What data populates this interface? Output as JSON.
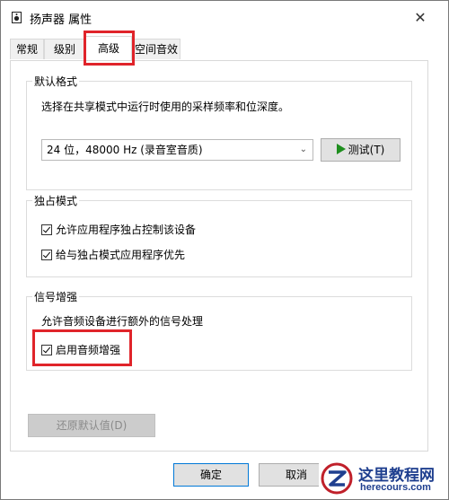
{
  "window": {
    "title": "扬声器 属性"
  },
  "tabs": [
    {
      "label": "常规"
    },
    {
      "label": "级别"
    },
    {
      "label": "高级"
    },
    {
      "label": "空间音效"
    }
  ],
  "default_format": {
    "title": "默认格式",
    "description": "选择在共享模式中运行时使用的采样频率和位深度。",
    "selected_format": "24 位，48000 Hz (录音室音质)",
    "test_button": "测试(T)"
  },
  "exclusive_mode": {
    "title": "独占模式",
    "options": [
      {
        "label": "允许应用程序独占控制该设备",
        "checked": true
      },
      {
        "label": "给与独占模式应用程序优先",
        "checked": true
      }
    ]
  },
  "signal_enhancement": {
    "title": "信号增强",
    "description": "允许音频设备进行额外的信号处理",
    "option": {
      "label": "启用音频增强",
      "checked": true
    }
  },
  "restore_defaults_button": "还原默认值(D)",
  "footer": {
    "ok_button": "确定",
    "cancel_button": "取消"
  },
  "watermark": {
    "title": "这里教程网",
    "url": "herecours.com"
  },
  "colors": {
    "highlight_red": "#e0242a",
    "play_green": "#1e8e1e",
    "primary_border": "#0078d7",
    "watermark_blue": "#1f3f8f"
  }
}
